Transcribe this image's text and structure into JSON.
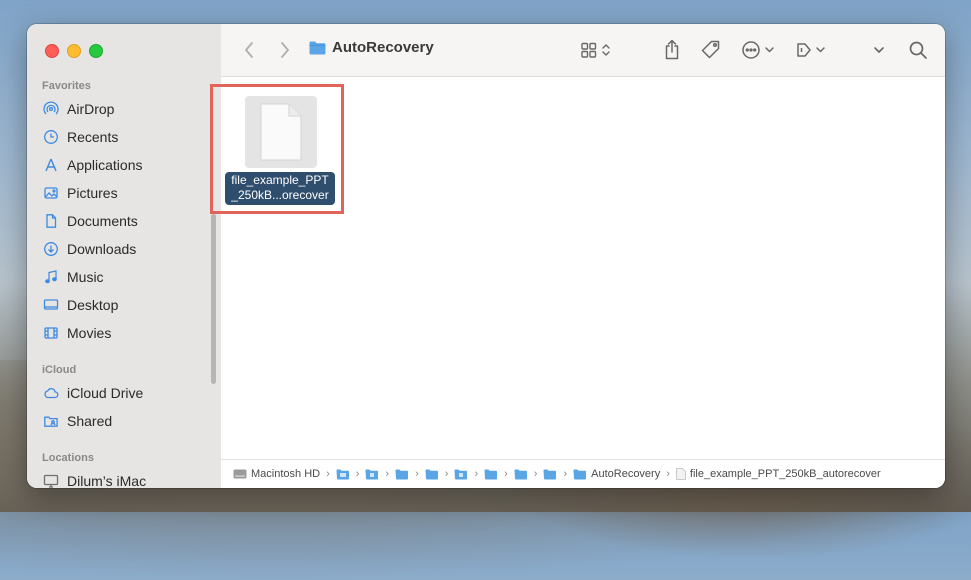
{
  "window": {
    "title": "AutoRecovery"
  },
  "sidebar": {
    "favorites_heading": "Favorites",
    "favorites": [
      {
        "label": "AirDrop",
        "icon": "airdrop-icon"
      },
      {
        "label": "Recents",
        "icon": "clock-icon"
      },
      {
        "label": "Applications",
        "icon": "applications-icon"
      },
      {
        "label": "Pictures",
        "icon": "photo-icon"
      },
      {
        "label": "Documents",
        "icon": "document-icon"
      },
      {
        "label": "Downloads",
        "icon": "download-icon"
      },
      {
        "label": "Music",
        "icon": "music-note-icon"
      },
      {
        "label": "Desktop",
        "icon": "desktop-icon"
      },
      {
        "label": "Movies",
        "icon": "film-icon"
      }
    ],
    "icloud_heading": "iCloud",
    "icloud": [
      {
        "label": "iCloud Drive",
        "icon": "cloud-icon"
      },
      {
        "label": "Shared",
        "icon": "shared-folder-icon"
      }
    ],
    "locations_heading": "Locations",
    "locations": [
      {
        "label": "Dilum’s iMac",
        "icon": "imac-icon"
      }
    ]
  },
  "content": {
    "file": {
      "label_line1": "file_example_PPT",
      "label_line2": "_250kB...orecover",
      "selected": true,
      "highlight_color": "#e06459"
    }
  },
  "pathbar": {
    "root": "Macintosh HD",
    "folder_count_unlabeled": 8,
    "folder": "AutoRecovery",
    "file": "file_example_PPT_250kB_autorecover"
  },
  "colors": {
    "accent": "#2f4d6d",
    "folder_blue": "#5aa5e6"
  }
}
